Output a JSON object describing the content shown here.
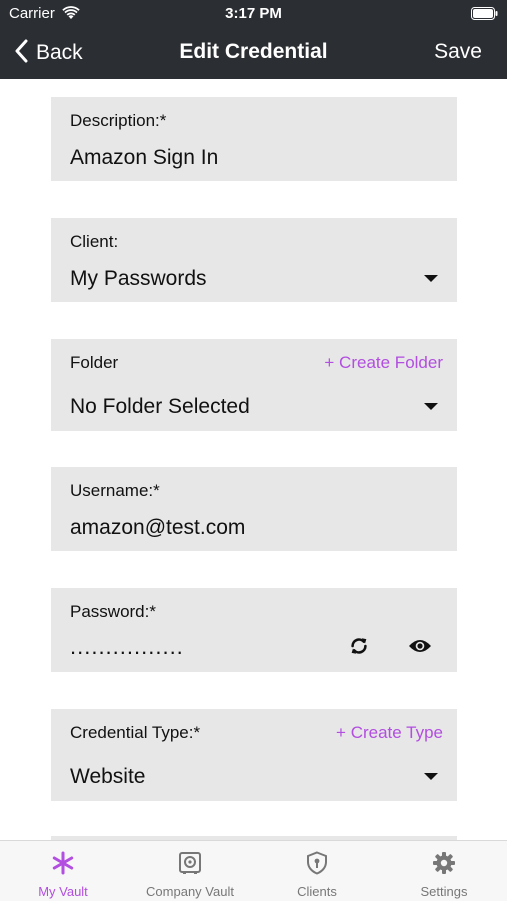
{
  "status_bar": {
    "carrier": "Carrier",
    "time": "3:17 PM"
  },
  "nav": {
    "back_label": "Back",
    "title": "Edit Credential",
    "save_label": "Save"
  },
  "form": {
    "description": {
      "label": "Description:*",
      "value": "Amazon Sign In"
    },
    "client": {
      "label": "Client:",
      "value": "My Passwords"
    },
    "folder": {
      "label": "Folder",
      "value": "No Folder Selected",
      "create_link": "+ Create Folder"
    },
    "username": {
      "label": "Username:*",
      "value": "amazon@test.com"
    },
    "password": {
      "label": "Password:*",
      "masked_value": "................"
    },
    "credential_type": {
      "label": "Credential Type:*",
      "value": "Website",
      "create_link": "+ Create Type"
    }
  },
  "tabs": [
    {
      "label": "My Vault",
      "icon": "asterisk-icon",
      "active": true
    },
    {
      "label": "Company Vault",
      "icon": "vault-icon",
      "active": false
    },
    {
      "label": "Clients",
      "icon": "shield-lock-icon",
      "active": false
    },
    {
      "label": "Settings",
      "icon": "gear-icon",
      "active": false
    }
  ],
  "colors": {
    "header_bg": "#2b2e33",
    "accent": "#b24ee0",
    "field_bg": "#e7e7e7"
  }
}
